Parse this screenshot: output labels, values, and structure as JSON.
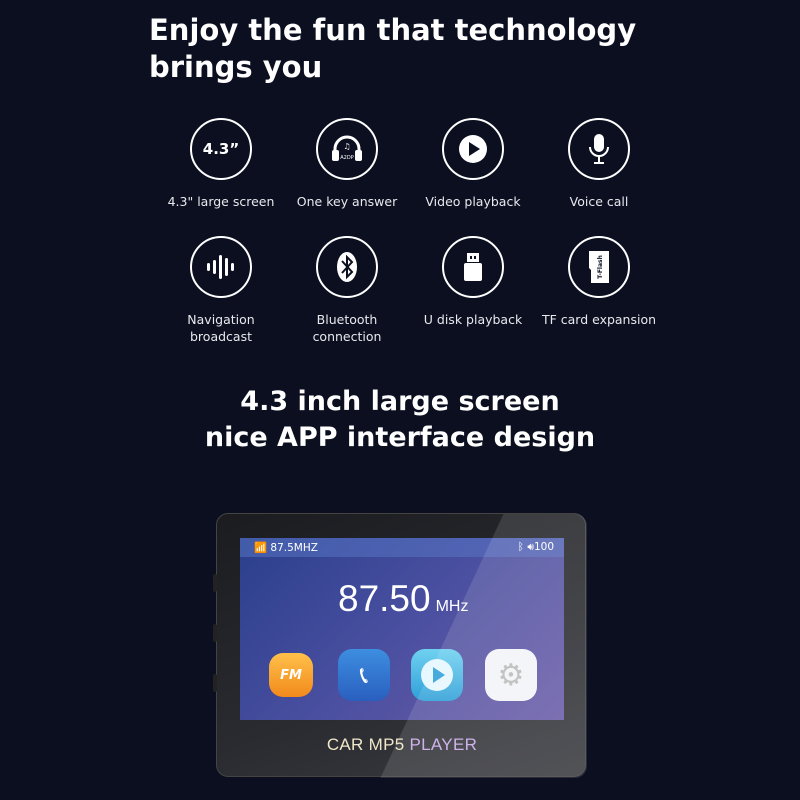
{
  "title": "Enjoy the fun that technology brings you",
  "features": [
    {
      "icon": "screen-size",
      "text": "4.3”",
      "label": "4.3\" large screen"
    },
    {
      "icon": "headphones",
      "text": "A2DP",
      "label": "One key answer"
    },
    {
      "icon": "play",
      "label": "Video playback"
    },
    {
      "icon": "microphone",
      "label": "Voice call"
    },
    {
      "icon": "sound-wave",
      "label": "Navigation broadcast"
    },
    {
      "icon": "bluetooth",
      "label": "Bluetooth connection"
    },
    {
      "icon": "usb-drive",
      "label": "U disk playback"
    },
    {
      "icon": "tf-card",
      "text": "T-Flash",
      "label": "TF card expansion"
    }
  ],
  "heading": {
    "line1": "4.3 inch large screen",
    "line2": "nice APP interface design"
  },
  "device": {
    "status": {
      "frequency": "87.5MHZ",
      "volume": "100"
    },
    "frequency": "87.50",
    "unit": "MHz",
    "apps": [
      {
        "name": "FM",
        "text": "FM"
      },
      {
        "name": "bluetooth-phone"
      },
      {
        "name": "video-player"
      },
      {
        "name": "settings"
      }
    ],
    "brand": {
      "part1": "CAR MP5 ",
      "part2": "PLAYER"
    }
  }
}
